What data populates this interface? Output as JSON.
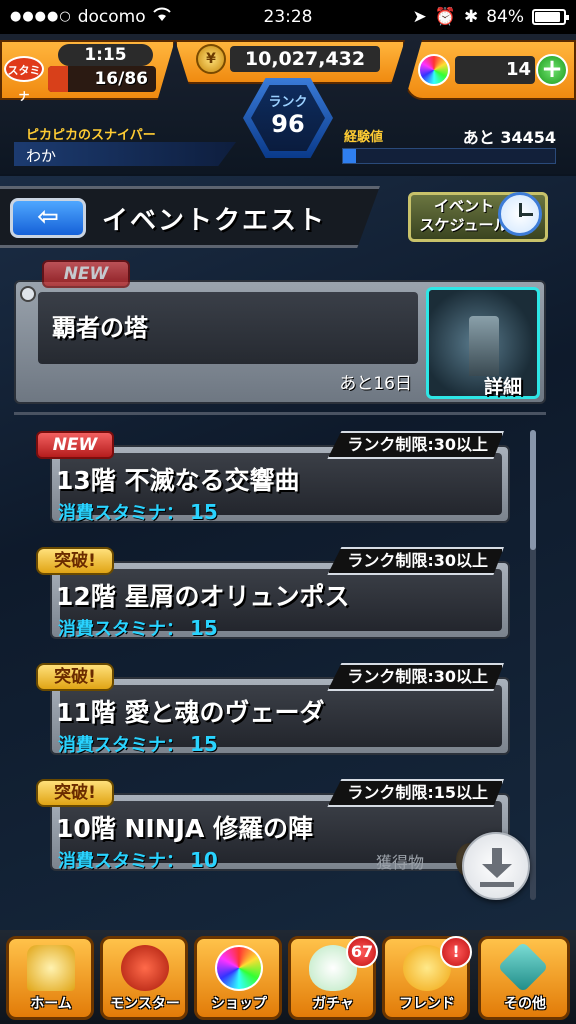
{
  "status_bar": {
    "signal": "●●●●○",
    "carrier": "docomo",
    "time": "23:28",
    "battery": "84%"
  },
  "header": {
    "stamina_label": "スタミナ",
    "stamina_timer": "1:15",
    "stamina_count": "16/86",
    "stamina_fraction": 0.186,
    "coins": "10,027,432",
    "orbs": "14",
    "rank_label": "ランク",
    "rank_value": "96",
    "player_title": "ピカピカのスナイパー",
    "player_name": "わか",
    "exp_label": "経験値",
    "exp_remaining": "あと 34454",
    "exp_fraction": 0.06
  },
  "page": {
    "title": "イベントクエスト",
    "back_glyph": "⇦",
    "schedule_button": "イベント\nスケジュール"
  },
  "featured": {
    "badge": "NEW",
    "name": "覇者の塔",
    "remaining": "あと16日",
    "detail": "詳細"
  },
  "quests": [
    {
      "badge": "NEW",
      "badge_type": "new",
      "limit": "ランク制限:30以上",
      "name": "13階 不滅なる交響曲",
      "stamina_label": "消費スタミナ：",
      "stamina": "15"
    },
    {
      "badge": "突破!",
      "badge_type": "breakthrough",
      "limit": "ランク制限:30以上",
      "name": "12階 星屑のオリュンポス",
      "stamina_label": "消費スタミナ：",
      "stamina": "15"
    },
    {
      "badge": "突破!",
      "badge_type": "breakthrough",
      "limit": "ランク制限:30以上",
      "name": "11階 愛と魂のヴェーダ",
      "stamina_label": "消費スタミナ：",
      "stamina": "15"
    },
    {
      "badge": "突破!",
      "badge_type": "breakthrough",
      "limit": "ランク制限:15以上",
      "name": "10階 NINJA 修羅の陣",
      "stamina_label": "消費スタミナ：",
      "stamina": "10",
      "drops_label": "獲得物"
    }
  ],
  "nav": {
    "home": "ホーム",
    "monster": "モンスター",
    "shop": "ショップ",
    "gacha": "ガチャ",
    "gacha_badge": "67",
    "friend": "フレンド",
    "friend_badge": "!",
    "other": "その他"
  }
}
